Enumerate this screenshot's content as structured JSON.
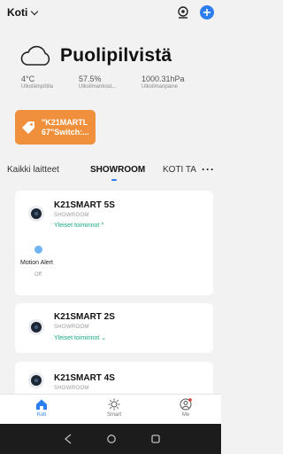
{
  "header": {
    "home_name": "Koti"
  },
  "weather": {
    "condition": "Puolipilvistä",
    "stats": [
      {
        "value": "4°C",
        "label": "Ulkolämpötila"
      },
      {
        "value": "57.5%",
        "label": "Ulkoilmankost..."
      },
      {
        "value": "1000.31hPa",
        "label": "Ulkoilmanpaine"
      }
    ]
  },
  "scene": {
    "title": "\"K21MARTL 67\"Switch:..."
  },
  "tabs": {
    "items": [
      "Kaikki laitteet",
      "SHOWROOM",
      "KOTI TA"
    ],
    "active": "SHOWROOM",
    "more": "···"
  },
  "devices": [
    {
      "name": "K21SMART 5S",
      "room": "SHOWROOM",
      "functions": "Yleiset toiminnot ^",
      "motion_label": "Motion Alert",
      "motion_value": "Off"
    },
    {
      "name": "K21SMART 2S",
      "room": "SHOWROOM",
      "functions": "Yleiset toiminnot ⌄"
    },
    {
      "name": "K21SMART 4S",
      "room": "SHOWROOM"
    }
  ],
  "bottom_nav": {
    "items": [
      "Koti",
      "Smart",
      "Me"
    ],
    "active": "Koti"
  },
  "colors": {
    "accent": "#2d7ff0",
    "scene": "#f0903c",
    "function_link": "#1aa882"
  }
}
